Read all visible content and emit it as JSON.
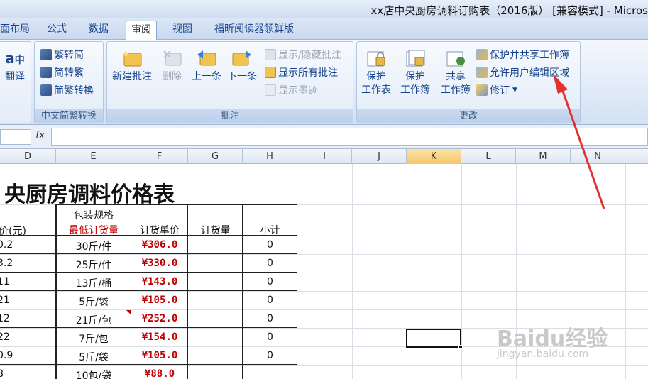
{
  "window": {
    "title": "xx店中央厨房调料订购表（2016版） [兼容模式] - Micros"
  },
  "tabs": [
    "面布局",
    "公式",
    "数据",
    "审阅",
    "视图",
    "福昕阅读器领鲜版"
  ],
  "ribbon": {
    "translate": {
      "label": "翻译"
    },
    "chinese_conv": {
      "items": [
        "繁转简",
        "简转繁",
        "简繁转换"
      ],
      "group_label": "中文简繁转换"
    },
    "comments": {
      "new": "新建批注",
      "delete": "删除",
      "prev": "上一条",
      "next": "下一条",
      "show_hide": "显示/隐藏批注",
      "show_all": "显示所有批注",
      "show_ink": "显示墨迹",
      "group_label": "批注"
    },
    "changes": {
      "protect_sheet": [
        "保护",
        "工作表"
      ],
      "protect_book": [
        "保护",
        "工作簿"
      ],
      "share_book": [
        "共享",
        "工作簿"
      ],
      "protect_share": "保护并共享工作簿",
      "allow_edit": "允许用户编辑区域",
      "track": "修订",
      "group_label": "更改"
    }
  },
  "formula_bar": {
    "fx": "fx",
    "value": ""
  },
  "columns": [
    "D",
    "E",
    "F",
    "G",
    "H",
    "I",
    "J",
    "K",
    "L",
    "M",
    "N"
  ],
  "selected_column": "K",
  "sheet": {
    "title": "央厨房调料价格表",
    "headers": {
      "d": "价(元)",
      "e_top": "包装规格",
      "e_bottom": "最低订货量",
      "f": "订货单价",
      "g": "订货量",
      "h": "小计"
    },
    "rows": [
      {
        "d": "0.2",
        "e": "30斤/件",
        "f": "¥306.0",
        "h": "0"
      },
      {
        "d": "3.2",
        "e": "25斤/件",
        "f": "¥330.0",
        "h": "0"
      },
      {
        "d": "11",
        "e": "13斤/桶",
        "f": "¥143.0",
        "h": "0"
      },
      {
        "d": "21",
        "e": "5斤/袋",
        "f": "¥105.0",
        "h": "0"
      },
      {
        "d": "12",
        "e": "21斤/包",
        "f": "¥252.0",
        "h": "0"
      },
      {
        "d": "22",
        "e": "7斤/包",
        "f": "¥154.0",
        "h": "0"
      },
      {
        "d": "0.9",
        "e": "5斤/袋",
        "f": "¥105.0",
        "h": "0"
      },
      {
        "d": "8",
        "e": "10包/袋",
        "f": "¥88.0",
        "h": ""
      }
    ]
  },
  "watermark": {
    "text": "Baidu经验",
    "url": "jingyan.baidu.com"
  },
  "colors": {
    "accent": "#15428b",
    "red": "#c00000",
    "arrow": "#e0322f"
  }
}
